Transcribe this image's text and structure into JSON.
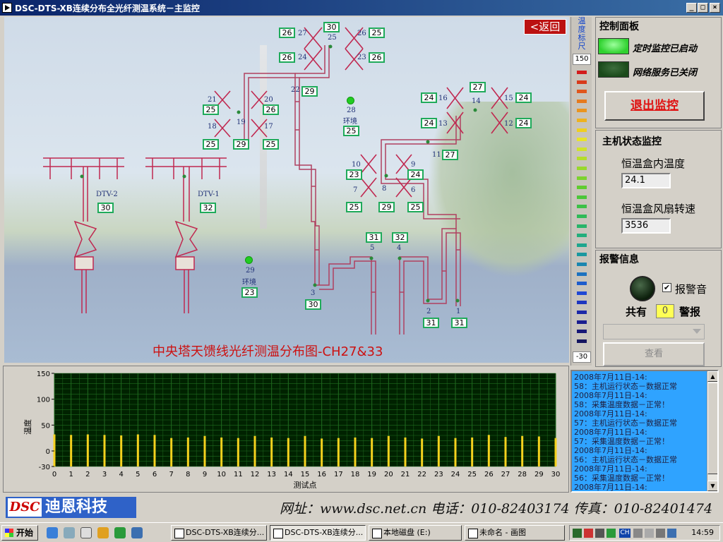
{
  "window": {
    "title": "DSC-DTS-XB连续分布全光纤测温系统－主监控",
    "btn_min": "_",
    "btn_max": "□",
    "btn_close": "×"
  },
  "map": {
    "back_label": "<返回",
    "title": "中央塔天馈线光纤测温分布图-CH27&33",
    "env_label": "环境",
    "sensors": [
      {
        "id": "27",
        "value": "26"
      },
      {
        "id": "25",
        "value": "30"
      },
      {
        "id": "26",
        "value": "25"
      },
      {
        "id": "24",
        "value": "26"
      },
      {
        "id": "23",
        "value": "26"
      },
      {
        "id": "22",
        "value": "29"
      },
      {
        "id": "21",
        "value": "25"
      },
      {
        "id": "20",
        "value": "26"
      },
      {
        "id": "18",
        "value": "25"
      },
      {
        "id": "19",
        "value": "29"
      },
      {
        "id": "17",
        "value": "25"
      },
      {
        "id": "28",
        "value": "25"
      },
      {
        "id": "14",
        "value": "27"
      },
      {
        "id": "16",
        "value": "24"
      },
      {
        "id": "15",
        "value": "24"
      },
      {
        "id": "13",
        "value": "24"
      },
      {
        "id": "12",
        "value": "24"
      },
      {
        "id": "11",
        "value": "27"
      },
      {
        "id": "10",
        "value": "23"
      },
      {
        "id": "9",
        "value": "24"
      },
      {
        "id": "7",
        "value": "25"
      },
      {
        "id": "8",
        "value": "29"
      },
      {
        "id": "6",
        "value": "25"
      },
      {
        "id": "DTV-2",
        "value": "30"
      },
      {
        "id": "DTV-1",
        "value": "32"
      },
      {
        "id": "5",
        "value": "31"
      },
      {
        "id": "4",
        "value": "32"
      },
      {
        "id": "29",
        "value": "23"
      },
      {
        "id": "3",
        "value": "30"
      },
      {
        "id": "2",
        "value": "31"
      },
      {
        "id": "1",
        "value": "31"
      }
    ],
    "node_labels": [
      "27",
      "25",
      "26",
      "24",
      "23",
      "22",
      "21",
      "20",
      "19",
      "18",
      "17",
      "28",
      "16",
      "14",
      "15",
      "13",
      "12",
      "11",
      "10",
      "9",
      "8",
      "7",
      "6",
      "DTV-2",
      "DTV-1",
      "5",
      "4",
      "29",
      "3",
      "2",
      "1"
    ]
  },
  "scale": {
    "title": "温度标尺",
    "max": "150",
    "min": "-30",
    "colors": [
      "#d21b1b",
      "#d83a1b",
      "#e0561c",
      "#e67a1e",
      "#ea951e",
      "#eeb21f",
      "#f0cf20",
      "#e8e32a",
      "#d0e22b",
      "#b4dd2b",
      "#98d82c",
      "#7cd22e",
      "#60cc30",
      "#4cc63a",
      "#3cc048",
      "#2fba58",
      "#28b46a",
      "#22ae7c",
      "#1ea68e",
      "#1a98a0",
      "#1a86b0",
      "#1c72c0",
      "#1e5ccc",
      "#2048d4",
      "#1e36c0",
      "#1c28a8",
      "#1a1e90",
      "#181878",
      "#141460"
    ]
  },
  "control": {
    "title": "控制面板",
    "timer_status": "定时监控已启动",
    "network_status": "网络服务已关闭",
    "exit_label": "退出监控",
    "timer_color": "#2fd12f",
    "network_color": "#1a4a1a"
  },
  "host": {
    "title": "主机状态监控",
    "temp_label": "恒温盒内温度",
    "temp_value": "24.1",
    "fan_label": "恒温盒风扇转速",
    "fan_value": "3536"
  },
  "alarm": {
    "title": "报警信息",
    "sound_label": "报警音",
    "sound_checked": "✔",
    "count_prefix": "共有",
    "count_value": "0",
    "count_suffix": "警报",
    "view_label": "查看"
  },
  "chart_data": {
    "type": "bar",
    "xlabel": "测试点",
    "ylabel": "温度",
    "ylim": [
      -30,
      150
    ],
    "yticks": [
      150,
      100,
      50,
      0,
      -30
    ],
    "grid": true,
    "categories": [
      "0",
      "1",
      "2",
      "3",
      "4",
      "5",
      "6",
      "7",
      "8",
      "9",
      "10",
      "11",
      "12",
      "13",
      "14",
      "15",
      "16",
      "17",
      "18",
      "19",
      "20",
      "21",
      "22",
      "23",
      "24",
      "25",
      "26",
      "27",
      "28",
      "29",
      "30"
    ],
    "values": [
      32,
      31,
      32,
      31,
      30,
      32,
      31,
      25,
      26,
      29,
      26,
      25,
      29,
      26,
      25,
      29,
      24,
      25,
      26,
      25,
      29,
      26,
      24,
      29,
      25,
      26,
      31,
      27,
      29,
      28,
      25
    ],
    "bar_color": "#f5d21e",
    "plot_bg": "#002200",
    "grid_color": "#1f6b1f"
  },
  "log": {
    "lines": [
      "2008年7月11日-14:",
      "58：主机运行状态－数据正常",
      "2008年7月11日-14:",
      "58：采集温度数据－正常！",
      "2008年7月11日-14:",
      "57：主机运行状态－数据正常",
      "2008年7月11日-14:",
      "57：采集温度数据－正常！",
      "2008年7月11日-14:",
      "56：主机运行状态－数据正常",
      "2008年7月11日-14:",
      "56：采集温度数据－正常！",
      "2008年7月11日-14:"
    ]
  },
  "footer": {
    "logo_mark": "DSC",
    "company": "迪恩科技",
    "contact": "网址：www.dsc.net.cn 电话：010-82403174 传真：010-82401474"
  },
  "taskbar": {
    "start": "开始",
    "tasks": [
      "DSC-DTS-XB连续分...",
      "DSC-DTS-XB连续分...",
      "本地磁盘 (E:)",
      "未命名 - 画图"
    ],
    "clock": "14:59",
    "tray_lang": "CH"
  }
}
